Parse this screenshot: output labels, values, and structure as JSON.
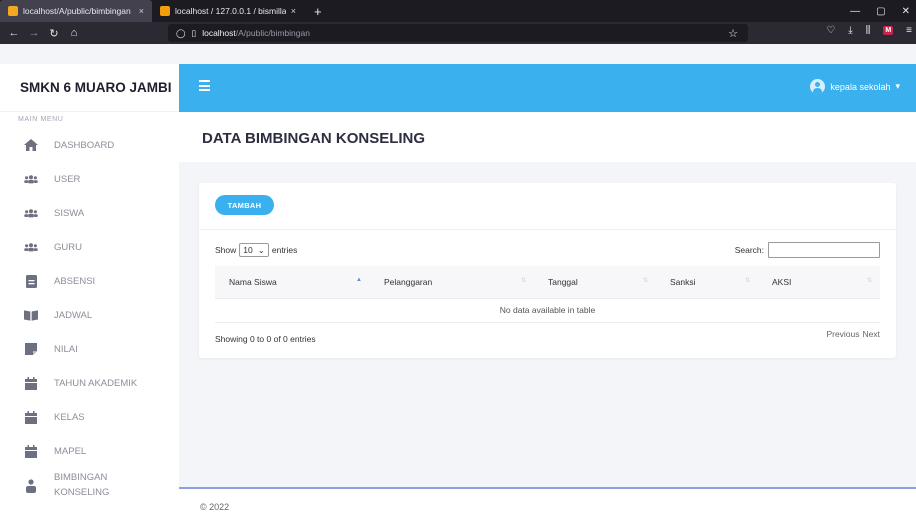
{
  "browser": {
    "tabs": [
      {
        "title": "localhost/A/public/bimbingan",
        "close": "×",
        "active": true,
        "favicon_color": "#f5a623"
      },
      {
        "title": "localhost / 127.0.0.1 / bismillah",
        "close": "×",
        "active": false,
        "favicon_color": "#f59e0b"
      }
    ],
    "new_tab": "+",
    "url_host": "localhost",
    "url_path": "/A/public/bimbingan",
    "window_controls": [
      "—",
      "▢",
      "✕"
    ]
  },
  "sidebar": {
    "brand": "SMKN 6 MUARO JAMBI",
    "heading": "MAIN MENU",
    "items": [
      {
        "label": "DASHBOARD",
        "icon": "home-icon"
      },
      {
        "label": "USER",
        "icon": "users-icon"
      },
      {
        "label": "SISWA",
        "icon": "users-icon"
      },
      {
        "label": "GURU",
        "icon": "users-icon"
      },
      {
        "label": "ABSENSI",
        "icon": "clipboard-icon"
      },
      {
        "label": "JADWAL",
        "icon": "book-icon"
      },
      {
        "label": "NILAI",
        "icon": "note-icon"
      },
      {
        "label": "TAHUN AKADEMIK",
        "icon": "calendar-icon"
      },
      {
        "label": "KELAS",
        "icon": "calendar-icon"
      },
      {
        "label": "MAPEL",
        "icon": "calendar-icon"
      },
      {
        "label": "BIMBINGAN",
        "label2": "KONSELING",
        "icon": "person-icon"
      }
    ]
  },
  "header": {
    "user_name": "kepala sekolah",
    "caret": "▾",
    "accent": "#3ab0ee"
  },
  "page": {
    "title": "DATA BIMBINGAN KONSELING"
  },
  "table": {
    "add_label": "TAMBAH",
    "show_label": "Show",
    "length_value": "10",
    "entries_label": "entries",
    "search_label": "Search:",
    "columns": [
      "Nama Siswa",
      "Pelanggaran",
      "Tanggal",
      "Sanksi",
      "AKSI"
    ],
    "empty_text": "No data available in table",
    "info": "Showing 0 to 0 of 0 entries",
    "prev_label": "Previous",
    "next_label": "Next"
  },
  "footer": {
    "text": "© 2022"
  }
}
